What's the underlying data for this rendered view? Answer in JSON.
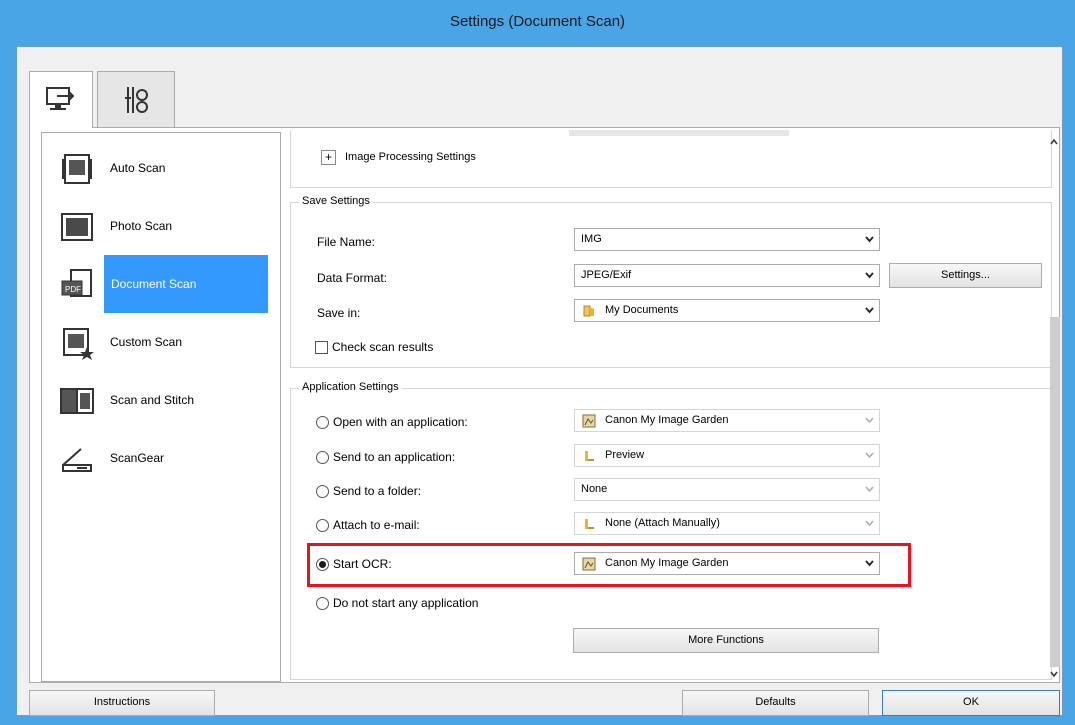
{
  "window": {
    "title": "Settings (Document Scan)"
  },
  "tabs": [
    {
      "icon": "monitor-scan-icon"
    },
    {
      "icon": "tools-icon"
    }
  ],
  "sidebar": {
    "items": [
      {
        "label": "Auto Scan",
        "icon": "auto-scan-icon"
      },
      {
        "label": "Photo Scan",
        "icon": "photo-scan-icon"
      },
      {
        "label": "Document Scan",
        "icon": "document-scan-icon",
        "selected": true
      },
      {
        "label": "Custom Scan",
        "icon": "custom-scan-icon"
      },
      {
        "label": "Scan and Stitch",
        "icon": "scan-and-stitch-icon"
      },
      {
        "label": "ScanGear",
        "icon": "scangear-icon"
      }
    ]
  },
  "image_processing": {
    "toggle": "+",
    "label": "Image Processing Settings"
  },
  "save_settings": {
    "title": "Save Settings",
    "file_name_label": "File Name:",
    "file_name_value": "IMG",
    "data_format_label": "Data Format:",
    "data_format_value": "JPEG/Exif",
    "settings_button": "Settings...",
    "save_in_label": "Save in:",
    "save_in_value": "My Documents",
    "check_scan_results": "Check scan results"
  },
  "application_settings": {
    "title": "Application Settings",
    "options": [
      {
        "label": "Open with an application:",
        "value": "Canon My Image Garden",
        "selected": false
      },
      {
        "label": "Send to an application:",
        "value": "Preview",
        "selected": false
      },
      {
        "label": "Send to a folder:",
        "value": "None",
        "selected": false
      },
      {
        "label": "Attach to e-mail:",
        "value": "None (Attach Manually)",
        "selected": false
      },
      {
        "label": "Start OCR:",
        "value": "Canon My Image Garden",
        "selected": true
      },
      {
        "label": "Do not start any application",
        "selected": false
      }
    ],
    "more_functions": "More Functions"
  },
  "footer": {
    "instructions": "Instructions",
    "defaults": "Defaults",
    "ok": "OK"
  },
  "colors": {
    "title_bar": "#4aa5e6",
    "selection": "#3399ff",
    "highlight": "#e8141e"
  }
}
